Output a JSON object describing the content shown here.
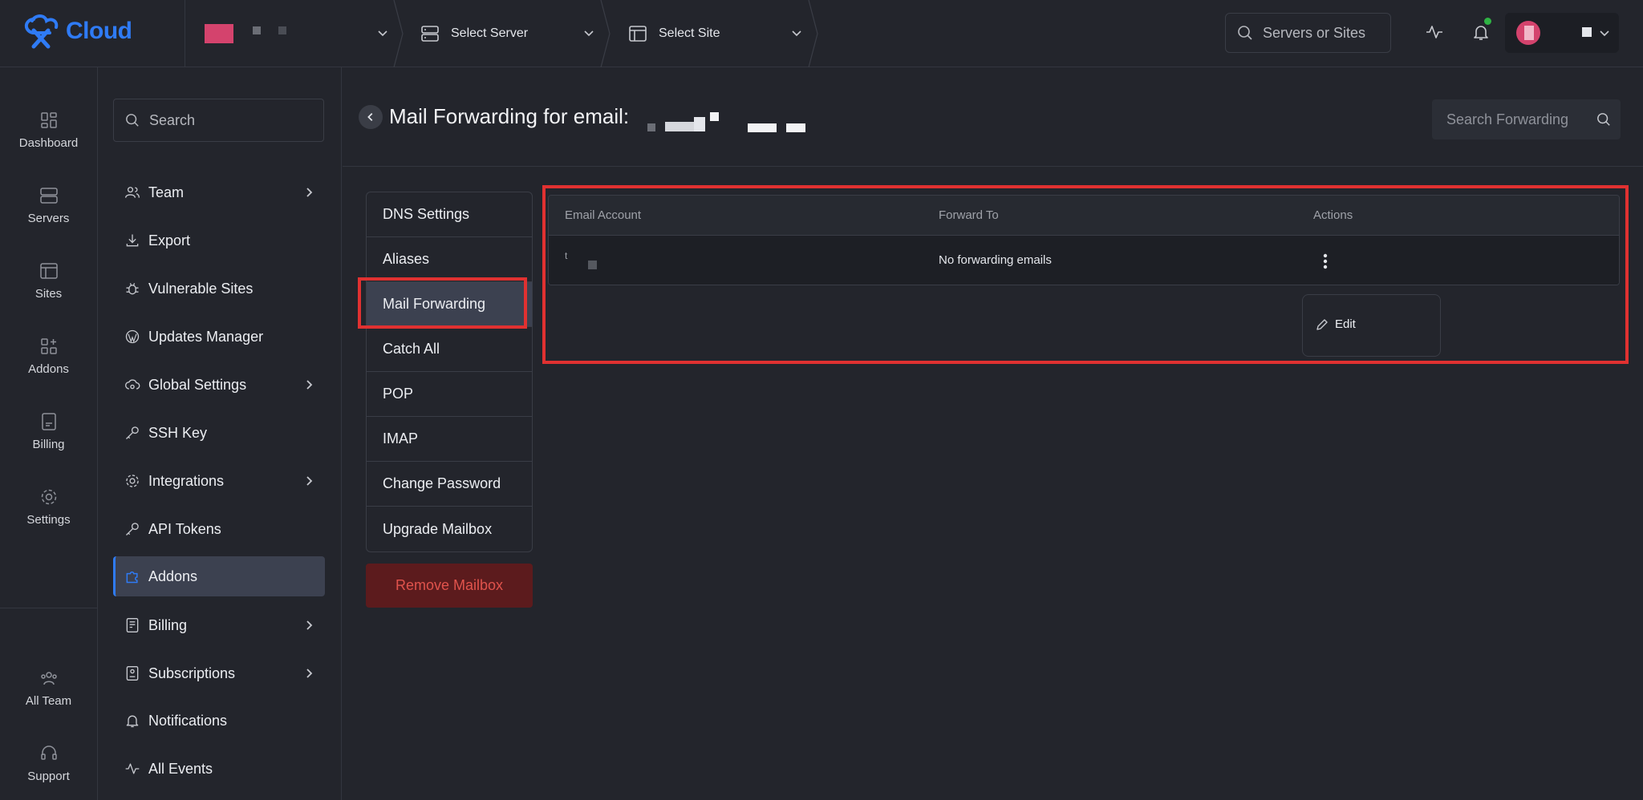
{
  "app": {
    "logo_text": "Cloud"
  },
  "topbar": {
    "server_select": "Select Server",
    "site_select": "Select Site",
    "search_placeholder": "Servers or Sites"
  },
  "rail": {
    "items": [
      {
        "label": "Dashboard",
        "icon": "dashboard-icon"
      },
      {
        "label": "Servers",
        "icon": "servers-icon"
      },
      {
        "label": "Sites",
        "icon": "sites-icon"
      },
      {
        "label": "Addons",
        "icon": "addons-icon"
      },
      {
        "label": "Billing",
        "icon": "billing-icon"
      },
      {
        "label": "Settings",
        "icon": "settings-icon"
      }
    ],
    "bottom": [
      {
        "label": "All Team",
        "icon": "team-icon"
      },
      {
        "label": "Support",
        "icon": "headset-icon"
      }
    ]
  },
  "sidebar": {
    "search_placeholder": "Search",
    "items": [
      {
        "label": "Team",
        "icon": "users-icon",
        "expandable": true
      },
      {
        "label": "Export",
        "icon": "download-icon",
        "expandable": false
      },
      {
        "label": "Vulnerable Sites",
        "icon": "bug-icon",
        "expandable": false
      },
      {
        "label": "Updates Manager",
        "icon": "wordpress-icon",
        "expandable": false
      },
      {
        "label": "Global Settings",
        "icon": "cloud-settings-icon",
        "expandable": true
      },
      {
        "label": "SSH Key",
        "icon": "key-icon",
        "expandable": false
      },
      {
        "label": "Integrations",
        "icon": "gear-icon",
        "expandable": true
      },
      {
        "label": "API Tokens",
        "icon": "key-icon",
        "expandable": false
      },
      {
        "label": "Addons",
        "icon": "puzzle-icon",
        "expandable": false,
        "active": true
      },
      {
        "label": "Billing",
        "icon": "invoice-icon",
        "expandable": true
      },
      {
        "label": "Subscriptions",
        "icon": "subscription-icon",
        "expandable": true
      },
      {
        "label": "Notifications",
        "icon": "bell-icon",
        "expandable": false
      },
      {
        "label": "All Events",
        "icon": "activity-icon",
        "expandable": false
      }
    ]
  },
  "main": {
    "title": "Mail Forwarding for email:",
    "search_placeholder": "Search Forwarding",
    "submenu": [
      "DNS Settings",
      "Aliases",
      "Mail Forwarding",
      "Catch All",
      "POP",
      "IMAP",
      "Change Password",
      "Upgrade Mailbox"
    ],
    "active_submenu": "Mail Forwarding",
    "remove_button": "Remove Mailbox",
    "table": {
      "columns": [
        "Email Account",
        "Forward To",
        "Actions"
      ],
      "rows": [
        {
          "email_account": "t",
          "forward_to": "No forwarding emails"
        }
      ]
    },
    "row_menu": {
      "edit_label": "Edit"
    }
  },
  "colors": {
    "accent": "#2f7bf5",
    "highlight": "#e03131",
    "danger_text": "#e0534c",
    "notification_dot": "#2fb344"
  }
}
